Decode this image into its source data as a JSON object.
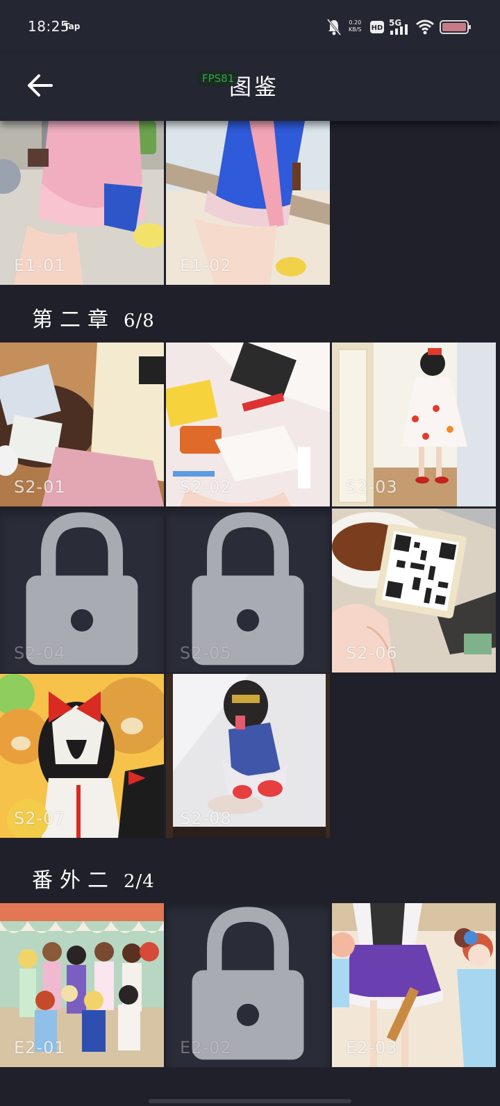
{
  "status_bar": {
    "time": "18:25",
    "app_hint": "Tap",
    "net_speed_value": "0.20",
    "net_speed_unit": "KB/S",
    "network": "5G",
    "hd": "HD"
  },
  "toolbar": {
    "title": "图鉴",
    "fps_overlay": "FPS81"
  },
  "sections": [
    {
      "tiles": [
        {
          "label": "E1-01",
          "locked": false
        },
        {
          "label": "E1-02",
          "locked": false
        }
      ]
    },
    {
      "title": "第二章",
      "count": "6/8",
      "tiles": [
        {
          "label": "S2-01",
          "locked": false
        },
        {
          "label": "S2-02",
          "locked": false
        },
        {
          "label": "S2-03",
          "locked": false
        },
        {
          "label": "S2-04",
          "locked": true
        },
        {
          "label": "S2-05",
          "locked": true
        },
        {
          "label": "S2-06",
          "locked": false
        },
        {
          "label": "S2-07",
          "locked": false
        },
        {
          "label": "S2-08",
          "locked": false
        }
      ]
    },
    {
      "title": "番外二",
      "count": "2/4",
      "tiles": [
        {
          "label": "E2-01",
          "locked": false
        },
        {
          "label": "E2-02",
          "locked": true
        },
        {
          "label": "E2-03",
          "locked": false
        }
      ]
    }
  ],
  "icons": {
    "back": "arrow-left-icon",
    "lock": "lock-icon",
    "bell": "bell-off-icon",
    "wifi": "wifi-icon",
    "battery": "battery-icon"
  },
  "colors": {
    "background": "#1f2029",
    "toolbar": "#242632",
    "locked_tile": "#2a2c38",
    "fps_text": "#2bb34b"
  }
}
